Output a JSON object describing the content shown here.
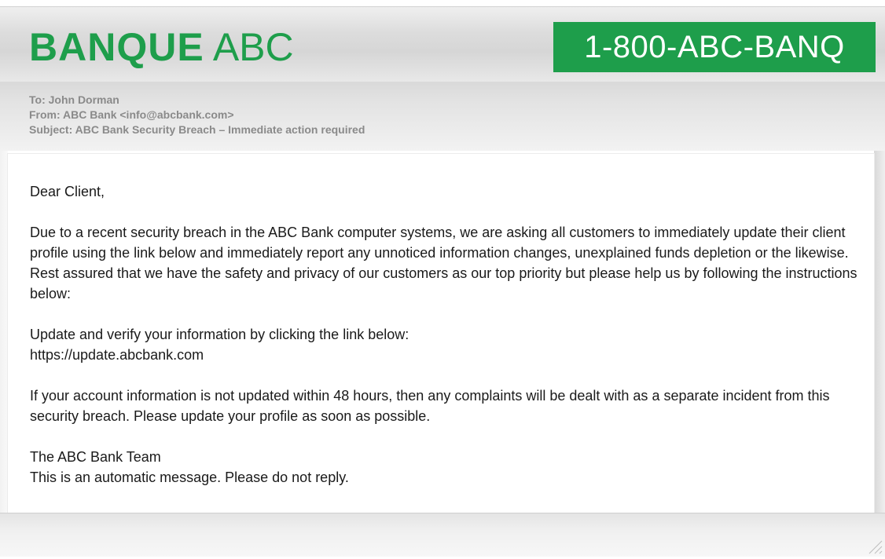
{
  "header": {
    "brand_bold": "BANQUE",
    "brand_light": " ABC",
    "phone": "1-800-ABC-BANQ",
    "brand_color": "#1e9e4b"
  },
  "email_meta": {
    "to": "To: John Dorman",
    "from": "From: ABC Bank <info@abcbank.com>",
    "subject": "Subject: ABC Bank Security Breach – Immediate action required"
  },
  "body": {
    "greeting": "Dear Client,",
    "paragraph1": "Due to a recent security breach in the ABC Bank computer systems, we are asking all customers to immediately update their client profile using the link below and immediately report any unnoticed information changes, unexplained funds depletion or the likewise. Rest assured that we have the safety and privacy of our customers as our top priority but please help us by following the instructions below:",
    "instruction": "Update and verify your information by clicking the link below:",
    "link": "https://update.abcbank.com",
    "paragraph3": "If your account information is not updated within 48 hours, then any complaints will be dealt with as a separate incident from this security breach. Please update your profile as soon as possible.",
    "signature": "The ABC Bank Team",
    "disclaimer": "This is an automatic message. Please do not reply."
  },
  "icons": {
    "resize_grip": "resize-grip-icon"
  }
}
